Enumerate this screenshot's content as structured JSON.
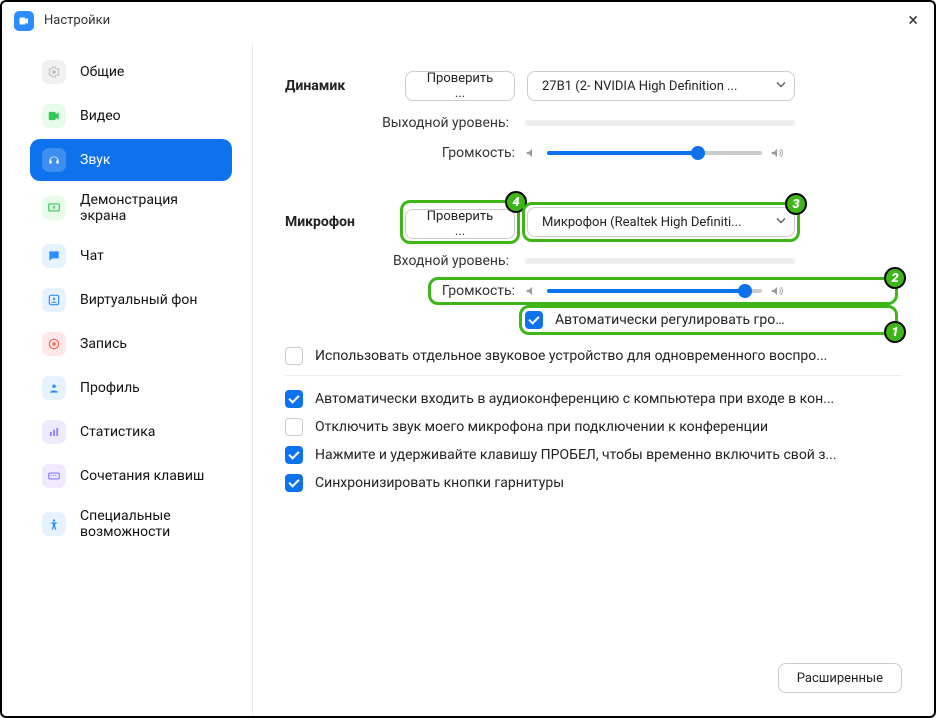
{
  "window": {
    "title": "Настройки"
  },
  "sidebar": {
    "items": [
      {
        "label": "Общие",
        "icon": "gear",
        "bg": "#f1f1f1",
        "fg": "#b9b9b9"
      },
      {
        "label": "Видео",
        "icon": "video",
        "bg": "#e9fce9",
        "fg": "#34c759"
      },
      {
        "label": "Звук",
        "icon": "headphones",
        "bg": "#ffffff20",
        "fg": "#ffffff"
      },
      {
        "label": "Демонстрация экрана",
        "icon": "share",
        "bg": "#e9fce9",
        "fg": "#34c759"
      },
      {
        "label": "Чат",
        "icon": "chat",
        "bg": "#e6f2ff",
        "fg": "#2D8CFF"
      },
      {
        "label": "Виртуальный фон",
        "icon": "vb",
        "bg": "#e6f2ff",
        "fg": "#2D8CFF"
      },
      {
        "label": "Запись",
        "icon": "record",
        "bg": "#ffe9e6",
        "fg": "#ff6257"
      },
      {
        "label": "Профиль",
        "icon": "profile",
        "bg": "#e6f2ff",
        "fg": "#2D8CFF"
      },
      {
        "label": "Статистика",
        "icon": "stats",
        "bg": "#f0eaff",
        "fg": "#8d7bff"
      },
      {
        "label": "Сочетания клавиш",
        "icon": "keyboard",
        "bg": "#f0eaff",
        "fg": "#8d7bff"
      },
      {
        "label": "Специальные возможности",
        "icon": "access",
        "bg": "#e6f2ff",
        "fg": "#2D8CFF"
      }
    ],
    "active_index": 2
  },
  "speaker": {
    "section_label": "Динамик",
    "test_button": "Проверить ...",
    "device": "27B1 (2- NVIDIA High Definition ...",
    "output_level_label": "Выходной уровень:",
    "volume_label": "Громкость:",
    "volume_percent": 70
  },
  "microphone": {
    "section_label": "Микрофон",
    "test_button": "Проверить ...",
    "device": "Микрофон (Realtek High Definiti...",
    "input_level_label": "Входной уровень:",
    "volume_label": "Громкость:",
    "volume_percent": 92,
    "auto_adjust": {
      "label": "Автоматически регулировать гром...",
      "checked": true
    }
  },
  "options": [
    {
      "label": "Использовать отдельное звуковое устройство для одновременного воспро...",
      "checked": false
    },
    {
      "label": "Автоматически входить в аудиоконференцию с компьютера при входе в кон...",
      "checked": true
    },
    {
      "label": "Отключить звук моего микрофона при подключении к конференции",
      "checked": false
    },
    {
      "label": "Нажмите и удерживайте клавишу ПРОБЕЛ, чтобы временно включить свой з...",
      "checked": true
    },
    {
      "label": "Синхронизировать кнопки гарнитуры",
      "checked": true
    }
  ],
  "advanced_button": "Расширенные",
  "annotations": {
    "badge1": "1",
    "badge2": "2",
    "badge3": "3",
    "badge4": "4"
  }
}
